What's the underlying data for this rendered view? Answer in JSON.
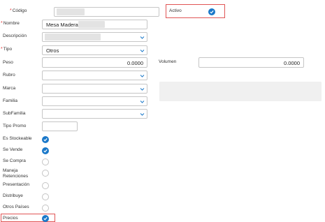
{
  "form": {
    "codigo": {
      "label": "Código",
      "value": ""
    },
    "activo": {
      "label": "Activo",
      "checked": true
    },
    "nombre": {
      "label": "Nombre",
      "value": "Mesa Madera"
    },
    "descripcion": {
      "label": "Descripción",
      "value": ""
    },
    "tipo": {
      "label": "Tipo",
      "value": "Otros"
    },
    "peso": {
      "label": "Peso",
      "value": "0.0000"
    },
    "volumen": {
      "label": "Volumen",
      "value": "0.0000"
    },
    "rubro": {
      "label": "Rubro",
      "value": ""
    },
    "marca": {
      "label": "Marca",
      "value": ""
    },
    "familia": {
      "label": "Familia",
      "value": ""
    },
    "subfamilia": {
      "label": "SubFamilia",
      "value": ""
    },
    "tipo_promo": {
      "label": "Tipo Promo",
      "value": ""
    },
    "checks": [
      {
        "label": "Es Stockeable",
        "checked": true
      },
      {
        "label": "Se Vende",
        "checked": true
      },
      {
        "label": "Se Compra",
        "checked": false
      },
      {
        "label": "Maneja Retenciones",
        "checked": false
      },
      {
        "label": "Presentación",
        "checked": false
      },
      {
        "label": "Distribuye",
        "checked": false
      },
      {
        "label": "Otros Países",
        "checked": false
      },
      {
        "label": "Precios",
        "checked": true
      }
    ]
  },
  "required_mark": "*",
  "colors": {
    "accent": "#1a78c9",
    "highlight": "#e05555",
    "required": "#e23b3b"
  }
}
